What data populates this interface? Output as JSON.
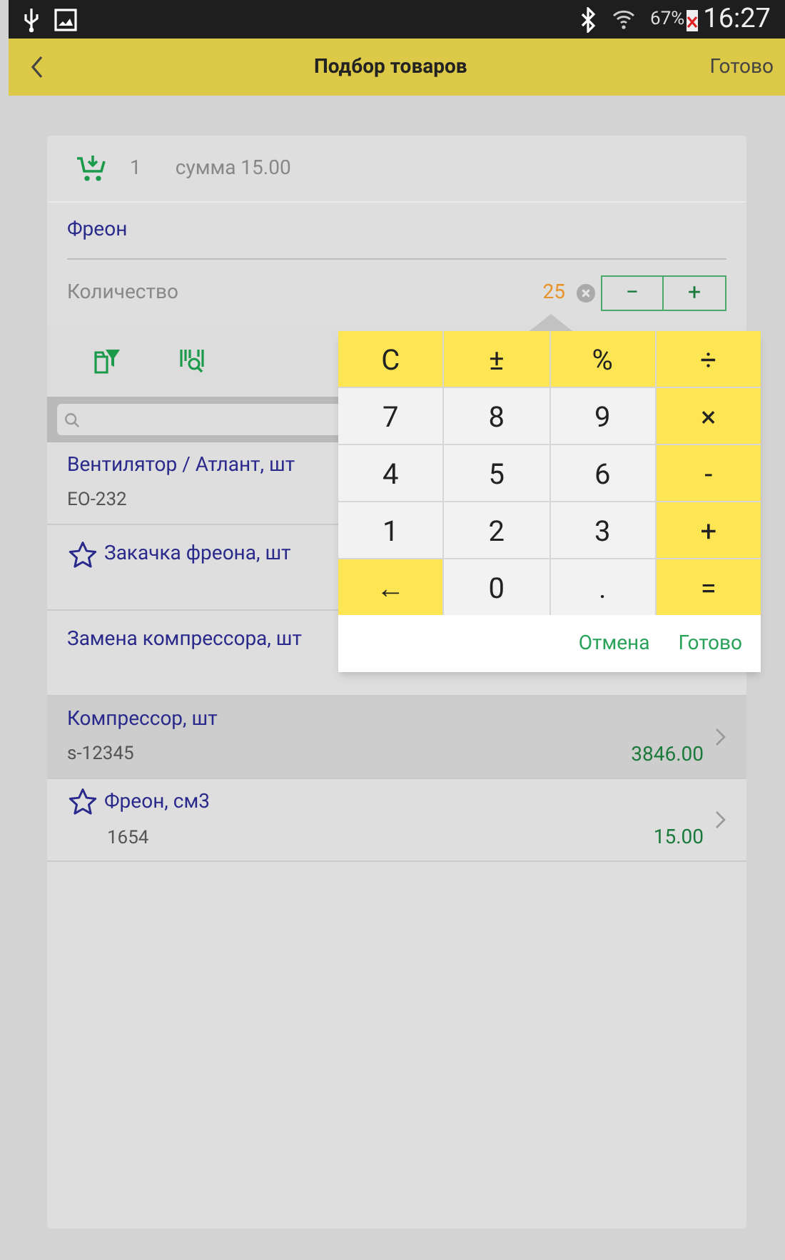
{
  "status_bar": {
    "battery": "67%",
    "time": "16:27"
  },
  "header": {
    "title": "Подбор товаров",
    "done": "Готово"
  },
  "summary": {
    "count": "1",
    "total": "сумма 15.00"
  },
  "field": {
    "value": "Фреон"
  },
  "quantity": {
    "label": "Количество",
    "value": "25",
    "minus": "−",
    "plus": "+"
  },
  "items": [
    {
      "name": "Вентилятор / Атлант, шт",
      "code": "EO-232",
      "favorite": false,
      "selected": false
    },
    {
      "name": "Закачка фреона, шт",
      "favorite": true,
      "selected": false
    },
    {
      "name": "Замена компрессора, шт",
      "favorite": false,
      "selected": false
    },
    {
      "name": "Компрессор, шт",
      "code": "s-12345",
      "price": "3846.00",
      "favorite": false,
      "selected": true
    },
    {
      "name": "Фреон, см3",
      "code": "1654",
      "price": "15.00",
      "favorite": true,
      "selected": false
    }
  ],
  "calculator": {
    "keys": [
      {
        "label": "C",
        "kind": "op"
      },
      {
        "label": "±",
        "kind": "op"
      },
      {
        "label": "%",
        "kind": "op"
      },
      {
        "label": "÷",
        "kind": "op"
      },
      {
        "label": "7",
        "kind": "digit"
      },
      {
        "label": "8",
        "kind": "digit"
      },
      {
        "label": "9",
        "kind": "digit"
      },
      {
        "label": "×",
        "kind": "op"
      },
      {
        "label": "4",
        "kind": "digit"
      },
      {
        "label": "5",
        "kind": "digit"
      },
      {
        "label": "6",
        "kind": "digit"
      },
      {
        "label": "-",
        "kind": "op"
      },
      {
        "label": "1",
        "kind": "digit"
      },
      {
        "label": "2",
        "kind": "digit"
      },
      {
        "label": "3",
        "kind": "digit"
      },
      {
        "label": "+",
        "kind": "op"
      },
      {
        "label": "←",
        "kind": "op"
      },
      {
        "label": "0",
        "kind": "digit"
      },
      {
        "label": ".",
        "kind": "digit"
      },
      {
        "label": "=",
        "kind": "op"
      }
    ],
    "cancel": "Отмена",
    "done": "Готово"
  }
}
